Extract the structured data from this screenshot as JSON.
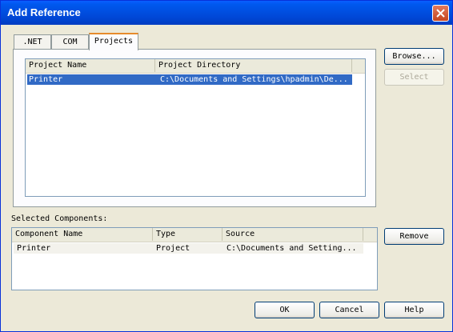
{
  "window": {
    "title": "Add Reference"
  },
  "tabs": [
    {
      "label": ".NET"
    },
    {
      "label": "COM"
    },
    {
      "label": "Projects"
    }
  ],
  "projects_list": {
    "columns": [
      "Project Name",
      "Project Directory"
    ],
    "rows": [
      {
        "name": "Printer",
        "directory": "C:\\Documents and Settings\\hpadmin\\De..."
      }
    ]
  },
  "buttons": {
    "browse": "Browse...",
    "select": "Select",
    "remove": "Remove",
    "ok": "OK",
    "cancel": "Cancel",
    "help": "Help"
  },
  "selected_components": {
    "label": "Selected Components:",
    "columns": [
      "Component Name",
      "Type",
      "Source"
    ],
    "rows": [
      {
        "name": "Printer",
        "type": "Project",
        "source": "C:\\Documents and Setting..."
      }
    ]
  },
  "colors": {
    "titlebar": "#0054e3",
    "selection": "#316ac5",
    "dialog_bg": "#ece9d8"
  }
}
